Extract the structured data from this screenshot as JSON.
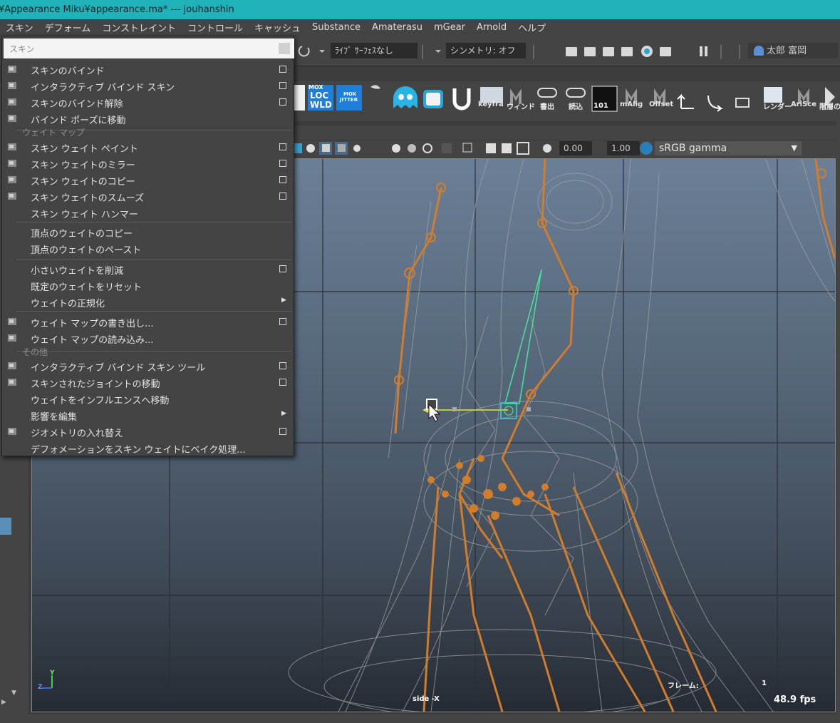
{
  "window": {
    "title": "¥Appearance Miku¥appearance.ma*  ---  jouhanshin"
  },
  "menubar": [
    "スキン",
    "デフォーム",
    "コンストレイント",
    "コントロール",
    "キャッシュ",
    "Substance",
    "Amaterasu",
    "mGear",
    "Arnold",
    "ヘルプ"
  ],
  "statusline": {
    "live_surface": "ﾗｲﾌﾞ ｻｰﾌｪｽなし",
    "symmetry": "シンメトリ: オフ",
    "user": "太郎 富岡"
  },
  "shelf": {
    "labels": [
      "keyfra",
      "ウィンド",
      "書出",
      "読込",
      "mAlig",
      "Offset",
      "レンダー",
      "AriSce",
      "階層の"
    ],
    "tex_labels": [
      "MOX",
      "LOC",
      "WLD",
      "MOX",
      "JITTER",
      "101"
    ]
  },
  "viewport_toolbar": {
    "exposure": "0.00",
    "gamma": "1.00",
    "color_space": "sRGB gamma"
  },
  "skin_menu": {
    "search_placeholder": "スキン",
    "items": [
      {
        "label": "スキンのバインド",
        "option": true,
        "icon": "bind-skin-icon"
      },
      {
        "label": "インタラクティブ バインド スキン",
        "option": true,
        "icon": "interactive-bind-icon"
      },
      {
        "label": "スキンのバインド解除",
        "option": true,
        "icon": "unbind-skin-icon"
      },
      {
        "label": "バインド ポーズに移動",
        "option": false,
        "icon": "bind-pose-icon"
      }
    ],
    "header_weight_map": "ウェイト マップ",
    "weight_items": [
      {
        "label": "スキン ウェイト ペイント",
        "option": true,
        "icon": "paint-weights-icon"
      },
      {
        "label": "スキン ウェイトのミラー",
        "option": true,
        "icon": "mirror-weights-icon"
      },
      {
        "label": "スキン ウェイトのコピー",
        "option": true,
        "icon": "copy-weights-icon"
      },
      {
        "label": "スキン ウェイトのスムーズ",
        "option": true,
        "icon": "smooth-weights-icon"
      },
      {
        "label": "スキン ウェイト ハンマー",
        "option": false,
        "icon": ""
      }
    ],
    "vertex_items": [
      {
        "label": "頂点のウェイトのコピー"
      },
      {
        "label": "頂点のウェイトのペースト"
      }
    ],
    "prune_items": [
      {
        "label": "小さいウェイトを削減",
        "option": true
      },
      {
        "label": "既定のウェイトをリセット",
        "option": false
      },
      {
        "label": "ウェイトの正規化",
        "submenu": true
      }
    ],
    "map_items": [
      {
        "label": "ウェイト マップの書き出し...",
        "option": true,
        "icon": "export-map-icon"
      },
      {
        "label": "ウェイト マップの読み込み...",
        "option": false,
        "icon": "import-map-icon"
      }
    ],
    "header_other": "その他",
    "other_items": [
      {
        "label": "インタラクティブ バインド スキン ツール",
        "option": true,
        "icon": "interactive-tool-icon"
      },
      {
        "label": "スキンされたジョイントの移動",
        "option": true,
        "icon": "move-joint-icon"
      },
      {
        "label": "ウェイトをインフルエンスへ移動",
        "option": false,
        "icon": ""
      },
      {
        "label": "影響を編集",
        "submenu": true,
        "icon": ""
      },
      {
        "label": "ジオメトリの入れ替え",
        "option": true,
        "icon": "replace-geometry-icon"
      },
      {
        "label": "デフォメーションをスキン ウェイトにベイク処理...",
        "option": false,
        "icon": ""
      }
    ]
  },
  "hud": {
    "camera": "side -X",
    "frame_label": "フレーム:",
    "frame_value": "1",
    "fps": "48.9 fps",
    "axis_y": "Y",
    "axis_z": "Z"
  },
  "colors": {
    "accent": "#1fb2b8",
    "joint": "#d27d2c",
    "mesh": "#9a9a9a",
    "selected_bone": "#46e39b"
  }
}
